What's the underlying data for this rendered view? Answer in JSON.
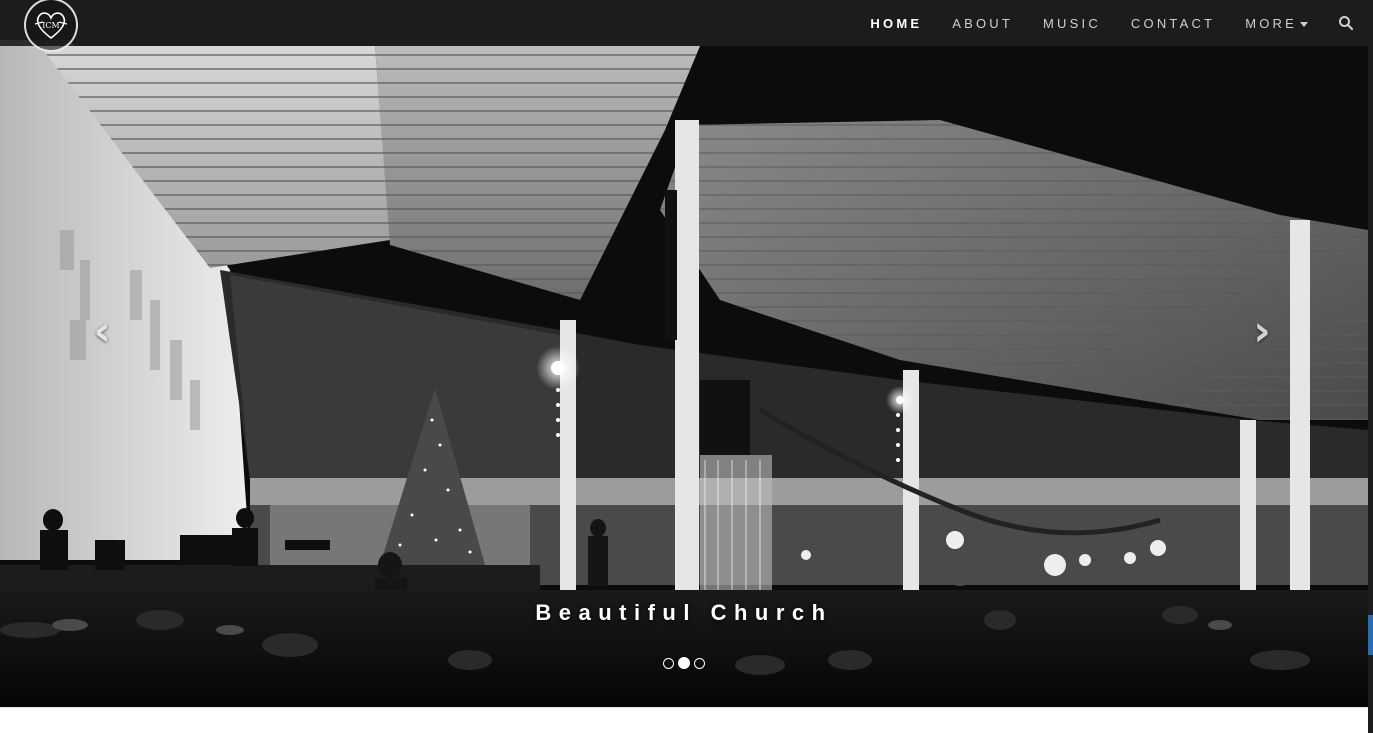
{
  "navbar": {
    "logo_text": "ICM",
    "items": [
      {
        "label": "HOME",
        "active": true
      },
      {
        "label": "ABOUT",
        "active": false
      },
      {
        "label": "MUSIC",
        "active": false
      },
      {
        "label": "CONTACT",
        "active": false
      },
      {
        "label": "MORE",
        "active": false,
        "dropdown": true
      }
    ],
    "search_icon": "search-icon"
  },
  "carousel": {
    "caption": "Beautiful Church",
    "prev_icon": "chevron-left-icon",
    "next_icon": "chevron-right-icon",
    "prev_glyph": "‹",
    "next_glyph": "›",
    "slide_count": 3,
    "active_slide": 2
  },
  "colors": {
    "navbar_bg": "#1e1e20",
    "nav_text": "#cfcfcf",
    "nav_active": "#ffffff"
  }
}
